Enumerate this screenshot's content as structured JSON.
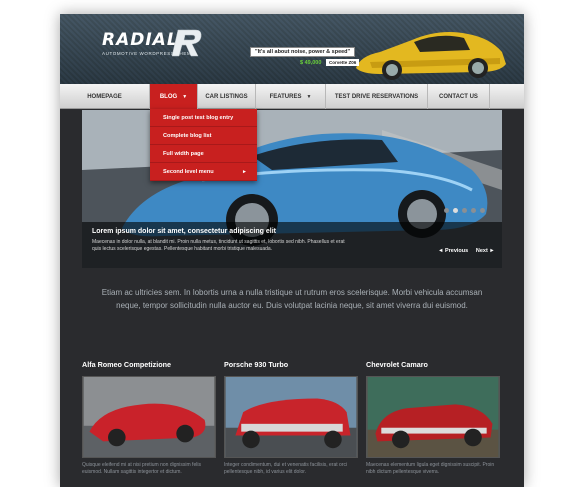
{
  "header": {
    "logo_text": "RADIAL",
    "logo_tag": "AUTOMOTIVE WORDPRESS THEME",
    "slogan": "\"It's all about noise, power & speed\"",
    "price": "$ 49,000",
    "model": "Corvette Z06"
  },
  "nav": {
    "items": [
      {
        "label": "HOMEPAGE"
      },
      {
        "label": "BLOG"
      },
      {
        "label": "CAR LISTINGS"
      },
      {
        "label": "FEATURES"
      },
      {
        "label": "TEST DRIVE RESERVATIONS"
      },
      {
        "label": "CONTACT US"
      }
    ]
  },
  "dropdown": {
    "items": [
      {
        "label": "Single post test blog entry"
      },
      {
        "label": "Complete blog list"
      },
      {
        "label": "Full width page"
      },
      {
        "label": "Second level menu"
      }
    ]
  },
  "slider": {
    "caption_title": "Lorem ipsum dolor sit amet, consectetur adipiscing elit",
    "caption_text": "Maecenas in dolor nulla, at blandit mi. Proin nulla metus, tincidunt ut sagittis et, lobortis sed nibh. Phasellus et erat quis lectus scelerisque egestas. Pellentesque habitant morbi tristique malesuada.",
    "prev_label": "◄ Previous",
    "next_label": "Next ►"
  },
  "intro": {
    "text": "Etiam ac ultricies sem. In lobortis urna a nulla tristique ut rutrum eros scelerisque. Morbi vehicula accumsan neque, tempor sollicitudin nulla auctor eu. Duis volutpat lacinia neque, sit amet viverra dui euismod."
  },
  "cards": [
    {
      "title": "Alfa Romeo Competizione",
      "text": "Quisque eleifend mi at nisi pretium non dignissim felis euismod. Nullam sagittis integertor et dictum."
    },
    {
      "title": "Porsche 930 Turbo",
      "text": "Integer condimentum, dui et venenatis facilisis, erat orci pellentesque nibh, id varius elit dolor."
    },
    {
      "title": "Chevrolet Camaro",
      "text": "Maecenas elementum ligula eget dignissim suscipit. Proin nibh dictum pellentesque viverra."
    }
  ]
}
